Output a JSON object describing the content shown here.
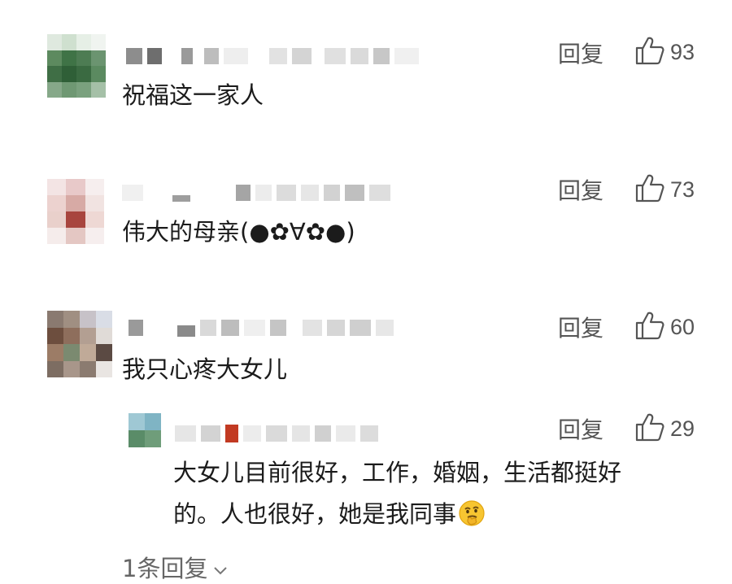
{
  "comments": [
    {
      "username": "",
      "text": "祝福这一家人",
      "reply_label": "回复",
      "likes": "93"
    },
    {
      "username": "",
      "text": "伟大的母亲(●✿∀✿●)",
      "reply_label": "回复",
      "likes": "73"
    },
    {
      "username": "",
      "text": "我只心疼大女儿",
      "reply_label": "回复",
      "likes": "60",
      "replies": [
        {
          "username": "",
          "text_line1": "大女儿目前很好，工作，婚姻，生活都挺好",
          "text_line2": "的。人也很好，她是我同事",
          "emoji": "thinking-emoji",
          "reply_label": "回复",
          "likes": "29"
        }
      ],
      "more_replies_label": "1条回复"
    }
  ],
  "icons": {
    "like": "thumbs-up-icon",
    "expand": "chevron-down-icon"
  },
  "colors": {
    "text": "#1b1b1b",
    "meta": "#555555",
    "background": "#ffffff"
  }
}
